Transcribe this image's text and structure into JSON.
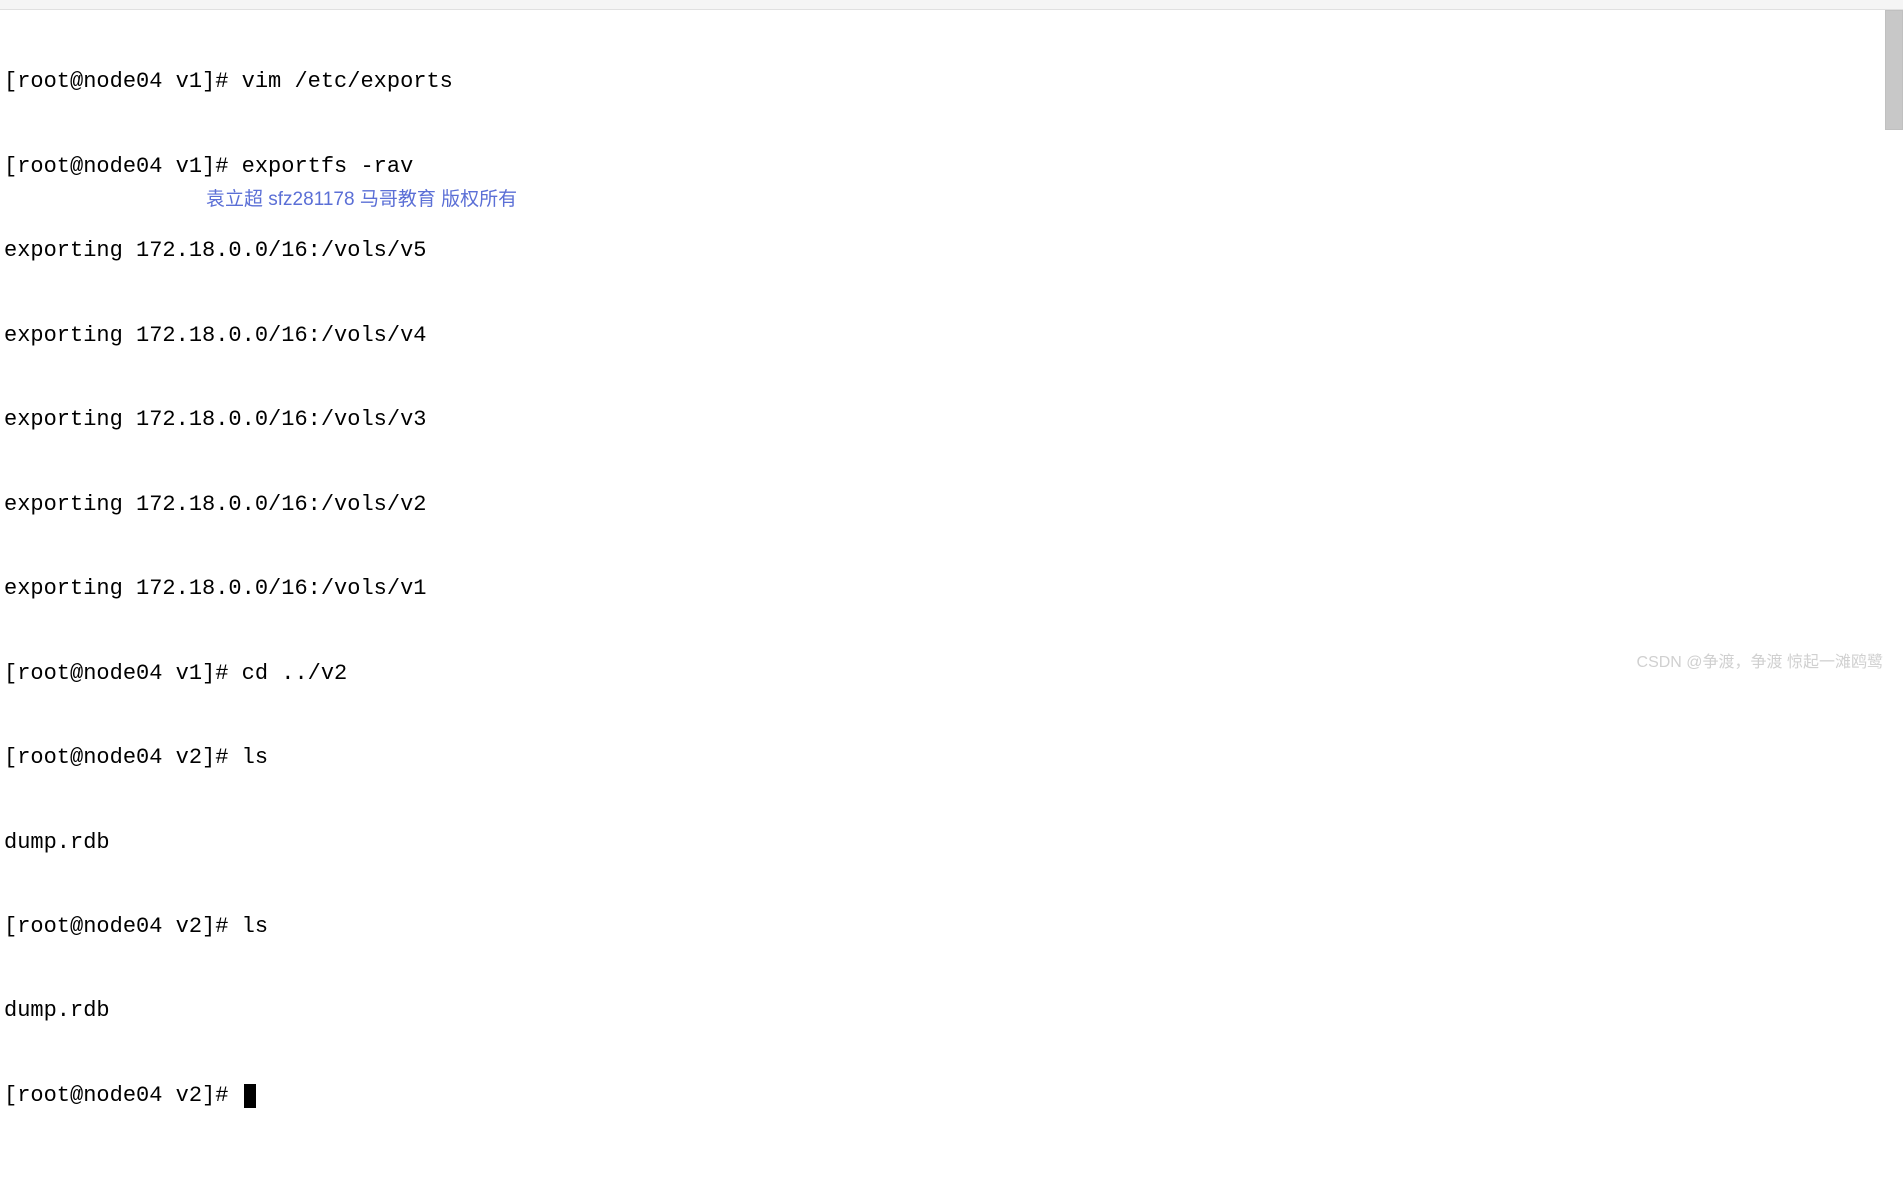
{
  "terminal": {
    "lines": [
      {
        "prompt": "[root@node04 v1]# ",
        "cmd": "vim /etc/exports"
      },
      {
        "prompt": "[root@node04 v1]# ",
        "cmd": "exportfs -rav"
      },
      {
        "text": "exporting 172.18.0.0/16:/vols/v5"
      },
      {
        "text": "exporting 172.18.0.0/16:/vols/v4"
      },
      {
        "text": "exporting 172.18.0.0/16:/vols/v3"
      },
      {
        "text": "exporting 172.18.0.0/16:/vols/v2"
      },
      {
        "text": "exporting 172.18.0.0/16:/vols/v1"
      },
      {
        "prompt": "[root@node04 v1]# ",
        "cmd": "cd ../v2"
      },
      {
        "prompt": "[root@node04 v2]# ",
        "cmd": "ls"
      },
      {
        "text": "dump.rdb"
      },
      {
        "prompt": "[root@node04 v2]# ",
        "cmd": "ls"
      },
      {
        "text": "dump.rdb"
      },
      {
        "prompt": "[root@node04 v2]# ",
        "cmd": "",
        "cursor": true
      }
    ]
  },
  "watermark_overlay": "袁立超 sfz281178 马哥教育 版权所有",
  "footer_watermark": "CSDN @争渡，争渡 惊起一滩鸥鹭"
}
